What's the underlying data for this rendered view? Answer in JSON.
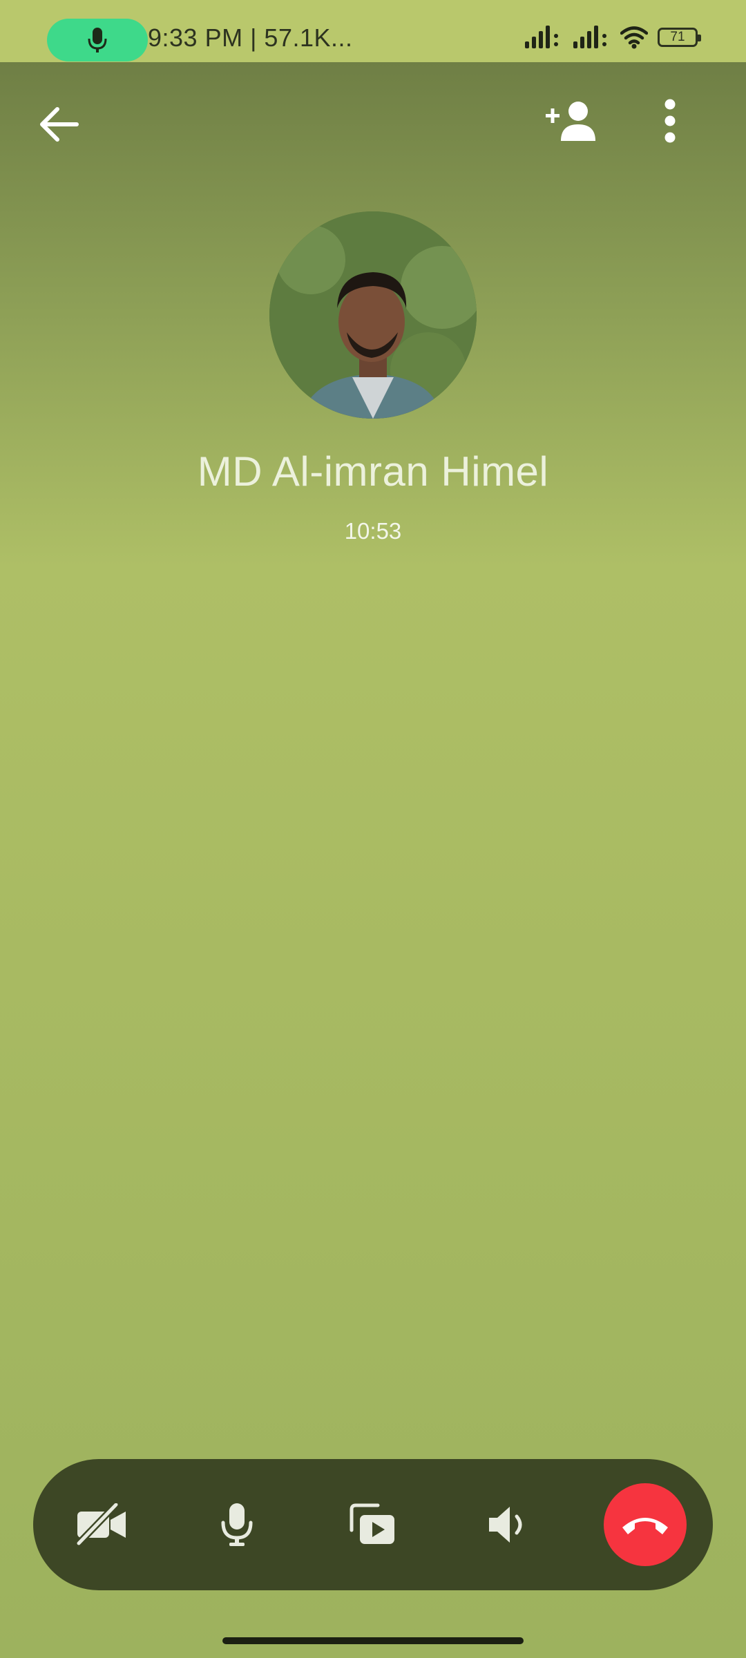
{
  "status_bar": {
    "time_network": "9:33 PM | 57.1K...",
    "battery_level": "71",
    "icons": [
      "mic-icon",
      "signal-icon",
      "signal-icon",
      "wifi-icon",
      "battery-icon"
    ]
  },
  "app_bar": {
    "icons": [
      "back-arrow-icon",
      "add-person-icon",
      "more-vertical-icon"
    ]
  },
  "caller": {
    "name": "MD Al-imran Himel",
    "duration": "10:53"
  },
  "controls": {
    "icons": [
      "video-off-icon",
      "mic-icon",
      "screen-share-icon",
      "speaker-icon",
      "end-call-icon"
    ]
  },
  "colors": {
    "status_bar_bg": "#b9c86c",
    "control_bar_bg": "#3d4725",
    "end_call": "#f6343f",
    "mic_indicator": "#3ed98a"
  }
}
